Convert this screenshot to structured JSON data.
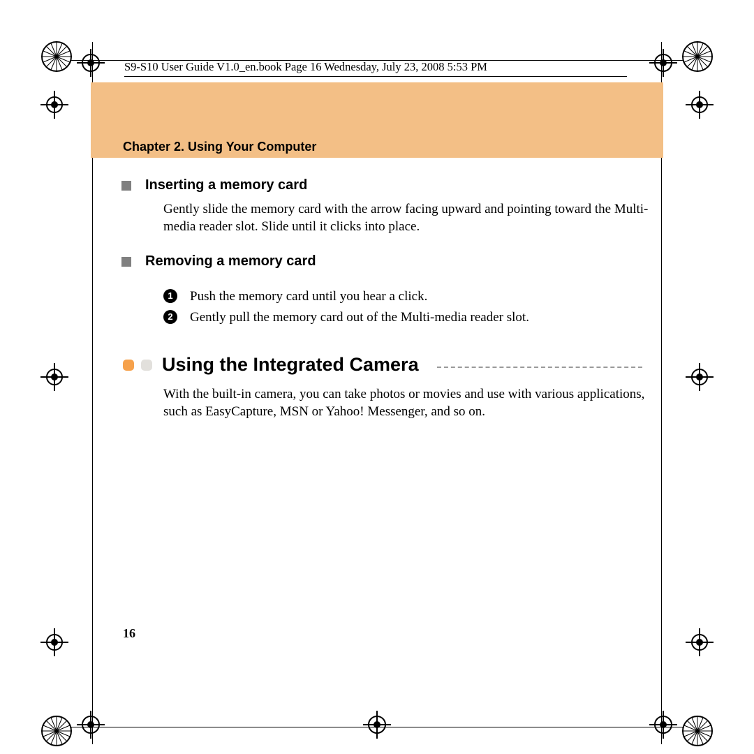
{
  "meta_line": "S9-S10 User Guide V1.0_en.book  Page 16  Wednesday, July 23, 2008  5:53 PM",
  "chapter_heading": "Chapter 2. Using Your Computer",
  "sections": {
    "insert": {
      "title": "Inserting a memory card",
      "body": "Gently slide the memory card with the arrow facing upward and pointing toward the Multi-media reader slot. Slide until it clicks into place."
    },
    "remove": {
      "title": "Removing a memory card",
      "steps": [
        "Push the memory card until you hear a click.",
        "Gently pull the memory card out of the Multi-media reader slot."
      ]
    },
    "camera": {
      "title": "Using the Integrated Camera",
      "body": "With the built-in camera, you can take photos or movies and use with various applications, such as EasyCapture, MSN or Yahoo! Messenger, and so on."
    }
  },
  "step_numbers": [
    "1",
    "2"
  ],
  "page_number": "16"
}
